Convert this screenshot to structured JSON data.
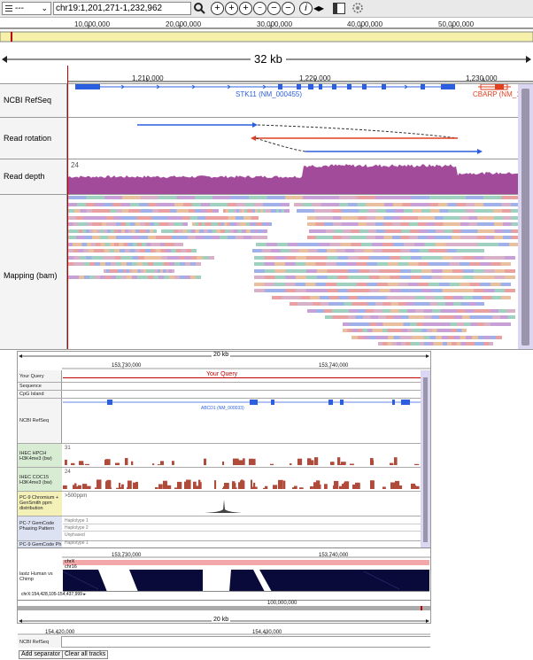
{
  "toolbar": {
    "species_select": "---",
    "location": "chr19:1,201,271-1,232,962",
    "icons": [
      "search-icon",
      "zoom-in-icon",
      "zoom-in-more-icon",
      "zoom-in-small-icon",
      "zoom-out-small-icon",
      "zoom-out-more-icon",
      "zoom-out-icon",
      "info-icon",
      "expand-icon",
      "panel-icon",
      "settings-icon"
    ]
  },
  "chromosome_ruler": {
    "ticks": [
      "10,000,000",
      "20,000,000",
      "30,000,000",
      "40,000,000",
      "50,000,000"
    ]
  },
  "scale": {
    "span_label": "32 kb"
  },
  "main_ruler": {
    "ticks": [
      "1,210,000",
      "1,220,000",
      "1,230,000"
    ]
  },
  "tracks": {
    "refseq": {
      "label": "NCBI RefSeq",
      "gene1": "STK11 (NM_000455)",
      "gene2": "CBARP (NM_1…"
    },
    "rotation": {
      "label": "Read rotation"
    },
    "depth": {
      "label": "Read depth",
      "max": "24"
    },
    "mapping": {
      "label": "Mapping (bam)"
    }
  },
  "panel2": {
    "scale_label": "20 kb",
    "ruler_ticks": [
      "153,730,000",
      "153,740,000"
    ],
    "query": {
      "label": "Your Query",
      "text": "Your Query"
    },
    "sequence_label": "Sequence",
    "cpg_label": "CpG Island",
    "refseq": {
      "label": "NCBI RefSeq",
      "gene": "ABCD1 (NM_000033)"
    },
    "ihec1": {
      "label": "IHEC HPCH H3K4me3 (bw)",
      "max": "31"
    },
    "ihec2": {
      "label": "IHEC COC15 H3K4me3 (bw)",
      "max": "24"
    },
    "pc9_chrom": {
      "label": "PC-9 Chromium + GenSmith ppm distribution",
      "max": ">500ppm"
    },
    "pc7_phasing": {
      "label": "PC-7 GemCode Phasing Pattern",
      "haplotypes": [
        "Haplotype 1",
        "Haplotype 2",
        "Unphased"
      ]
    },
    "pc9_gem": {
      "label": "PC-9 GemCode Ph",
      "haplotypes": [
        "Haplotype 1"
      ]
    },
    "align_ruler_ticks": [
      "153,730,000",
      "153,740,000"
    ],
    "align": {
      "label": "lastz Human vs Chimp",
      "chr_a": "chrX",
      "chr_b": "chr16",
      "coord": "chrX:154,428,105-154,437,999 ▸"
    },
    "overview_tick": "100,000,000"
  },
  "panel3": {
    "scale_label": "20 kb",
    "ruler_ticks": [
      "154,420,000",
      "154,430,000"
    ],
    "refseq_label": "NCBI RefSeq",
    "buttons": [
      "Add separator",
      "Clear all tracks"
    ]
  },
  "colors": {
    "gene": "#2c5fe0",
    "gene2": "#e04020",
    "depth": "#a24b9a",
    "cursor": "#c00000",
    "chrom_bar": "#f6f0a8"
  }
}
